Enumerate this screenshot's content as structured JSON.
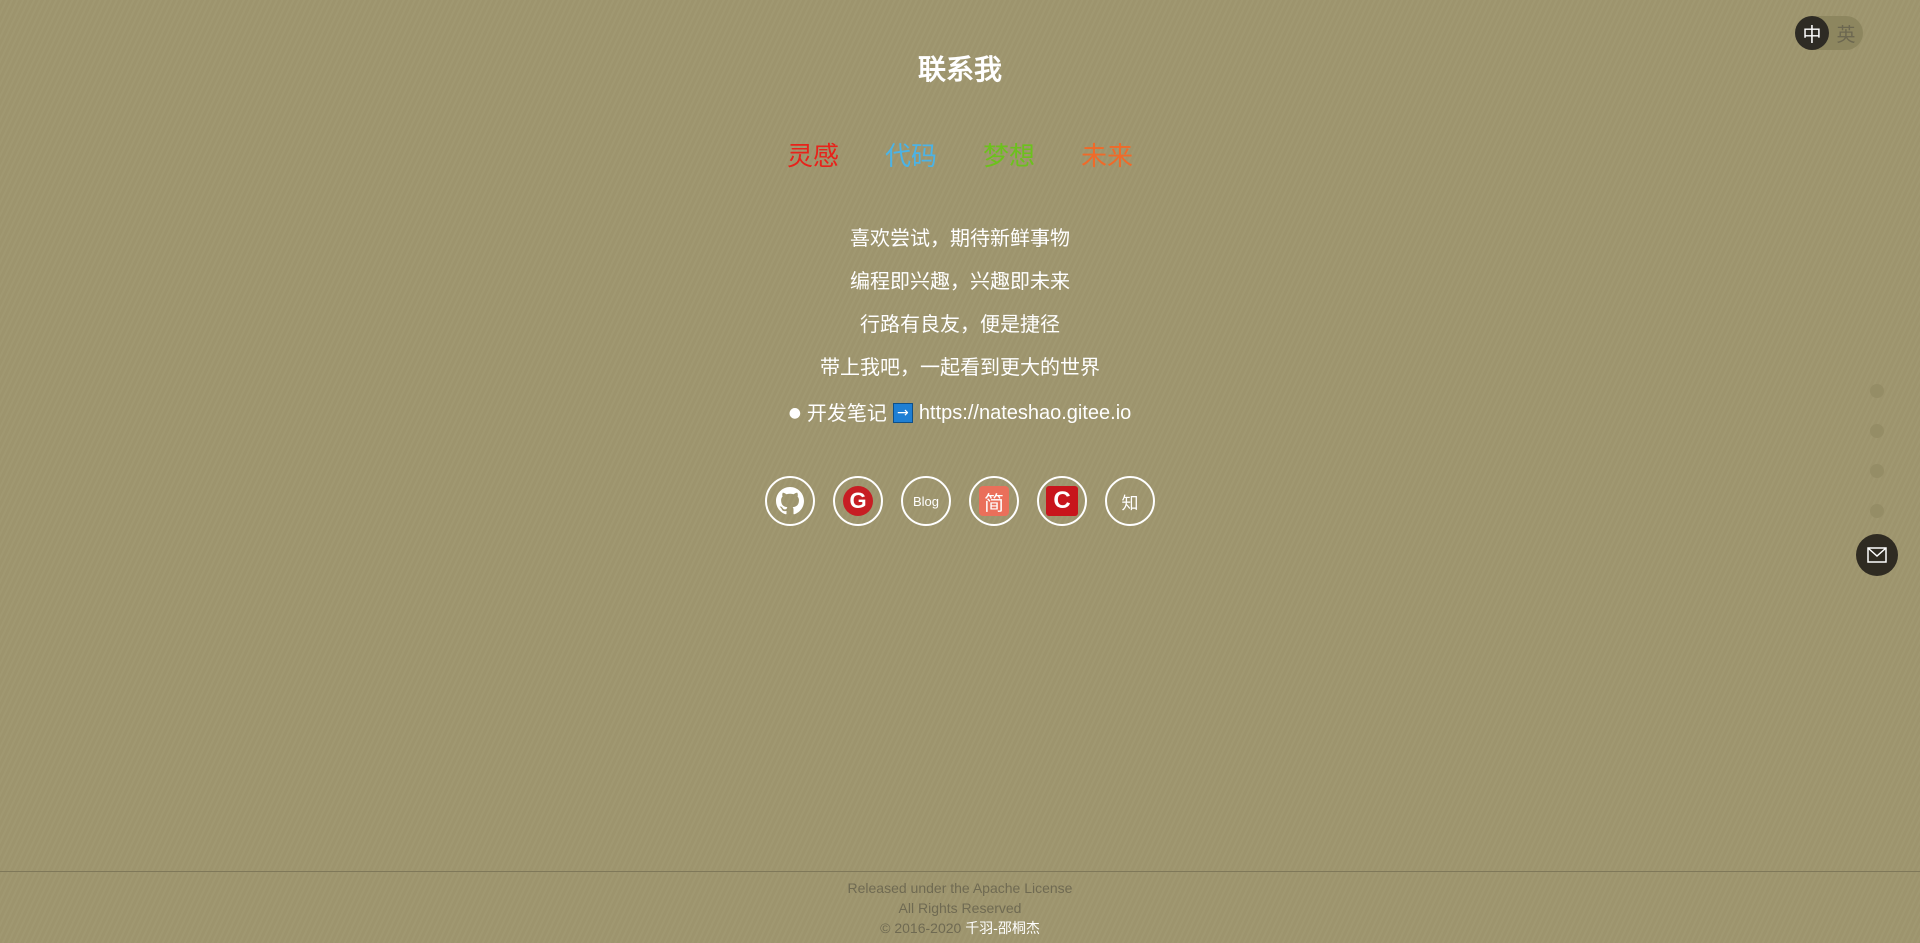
{
  "lang_toggle": {
    "active": "中",
    "inactive": "英"
  },
  "title": "联系我",
  "tags": [
    {
      "label": "灵感",
      "color": "#e8221a"
    },
    {
      "label": "代码",
      "color": "#4bb3e6"
    },
    {
      "label": "梦想",
      "color": "#6cc11d"
    },
    {
      "label": "未来",
      "color": "#f06a29"
    }
  ],
  "lines": [
    "喜欢尝试，期待新鲜事物",
    "编程即兴趣，兴趣即未来",
    "行路有良友，便是捷径",
    "带上我吧，一起看到更大的世界"
  ],
  "note": {
    "bullet": "●",
    "label": "开发笔记",
    "arrow": "→",
    "url": "https://nateshao.gitee.io"
  },
  "socials": [
    {
      "name": "github",
      "icon": "github-icon"
    },
    {
      "name": "gitee",
      "icon": "gitee-icon",
      "text": "G"
    },
    {
      "name": "blog",
      "icon": "blog-icon",
      "text": "Blog"
    },
    {
      "name": "jianshu",
      "icon": "jianshu-icon",
      "text": "简"
    },
    {
      "name": "csdn",
      "icon": "csdn-icon",
      "text": "C"
    },
    {
      "name": "zhihu",
      "icon": "zhihu-icon",
      "text": "知"
    }
  ],
  "side_nav": {
    "dots": 4,
    "mail_icon": "mail-icon"
  },
  "footer": {
    "license": "Released under the Apache License",
    "rights": "All Rights Reserved",
    "copyright": "© 2016-2020",
    "author": "千羽-邵桐杰"
  }
}
